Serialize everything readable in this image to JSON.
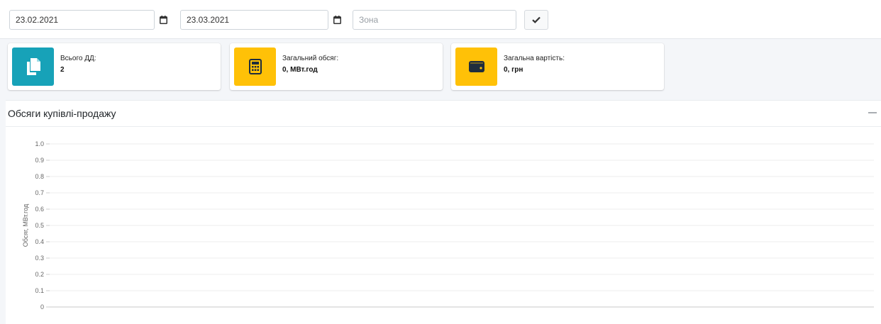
{
  "filters": {
    "date_from": "23.02.2021",
    "date_to": "23.03.2021",
    "zone_placeholder": "Зона",
    "zone_value": ""
  },
  "cards": [
    {
      "label": "Всього ДД:",
      "value": "2",
      "icon": "files-icon",
      "color": "#17a2b8"
    },
    {
      "label": "Загальний обсяг:",
      "value": "0, МВт.год",
      "icon": "calculator-icon",
      "color": "#ffc107"
    },
    {
      "label": "Загальна вартість:",
      "value": "0, грн",
      "icon": "wallet-icon",
      "color": "#ffc107"
    }
  ],
  "panel": {
    "title": "Обсяги купівлі-продажу"
  },
  "chart_data": {
    "type": "line",
    "title": "",
    "xlabel": "",
    "ylabel": "Обсяг, МВт.год",
    "ylim": [
      0,
      1.0
    ],
    "yticks": [
      "0",
      "0.1",
      "0.2",
      "0.3",
      "0.4",
      "0.5",
      "0.6",
      "0.7",
      "0.8",
      "0.9",
      "1.0"
    ],
    "grid": true,
    "series": []
  }
}
